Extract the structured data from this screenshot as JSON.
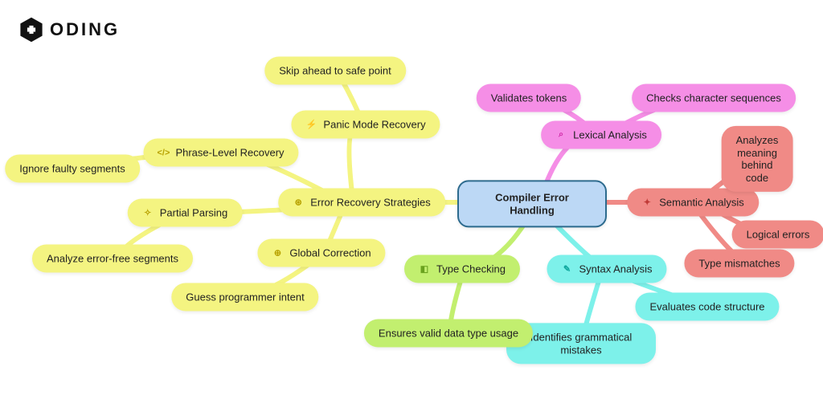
{
  "brand": "ODING",
  "root": {
    "label": "Compiler Error Handling"
  },
  "branches": {
    "lexical": {
      "label": "Lexical Analysis",
      "color": "#f58ee6",
      "children": [
        "Validates tokens",
        "Checks character sequences"
      ]
    },
    "semantic": {
      "label": "Semantic Analysis",
      "color": "#f08a86",
      "children": [
        "Analyzes meaning behind code",
        "Logical errors",
        "Type mismatches"
      ]
    },
    "syntax": {
      "label": "Syntax Analysis",
      "color": "#7df1ea",
      "children": [
        "Evaluates code structure",
        "Identifies grammatical mistakes"
      ]
    },
    "type": {
      "label": "Type Checking",
      "color": "#c2ef6f",
      "children": [
        "Ensures valid data type usage"
      ]
    },
    "recovery": {
      "label": "Error Recovery Strategies",
      "color": "#f4f481",
      "subs": {
        "panic": {
          "label": "Panic Mode Recovery",
          "children": [
            "Skip ahead to safe point"
          ]
        },
        "phrase": {
          "label": "Phrase-Level Recovery",
          "children": [
            "Ignore faulty segments"
          ]
        },
        "partial": {
          "label": "Partial Parsing",
          "children": [
            "Analyze error-free segments"
          ]
        },
        "global": {
          "label": "Global Correction",
          "children": [
            "Guess programmer intent"
          ]
        }
      }
    }
  },
  "chart_data": {
    "type": "mindmap",
    "root": "Compiler Error Handling",
    "branches": [
      {
        "name": "Lexical Analysis",
        "leaves": [
          "Validates tokens",
          "Checks character sequences"
        ]
      },
      {
        "name": "Semantic Analysis",
        "leaves": [
          "Analyzes meaning behind code",
          "Logical errors",
          "Type mismatches"
        ]
      },
      {
        "name": "Syntax Analysis",
        "leaves": [
          "Evaluates code structure",
          "Identifies grammatical mistakes"
        ]
      },
      {
        "name": "Type Checking",
        "leaves": [
          "Ensures valid data type usage"
        ]
      },
      {
        "name": "Error Recovery Strategies",
        "children": [
          {
            "name": "Panic Mode Recovery",
            "leaves": [
              "Skip ahead to safe point"
            ]
          },
          {
            "name": "Phrase-Level Recovery",
            "leaves": [
              "Ignore faulty segments"
            ]
          },
          {
            "name": "Partial Parsing",
            "leaves": [
              "Analyze error-free segments"
            ]
          },
          {
            "name": "Global Correction",
            "leaves": [
              "Guess programmer intent"
            ]
          }
        ]
      }
    ]
  }
}
